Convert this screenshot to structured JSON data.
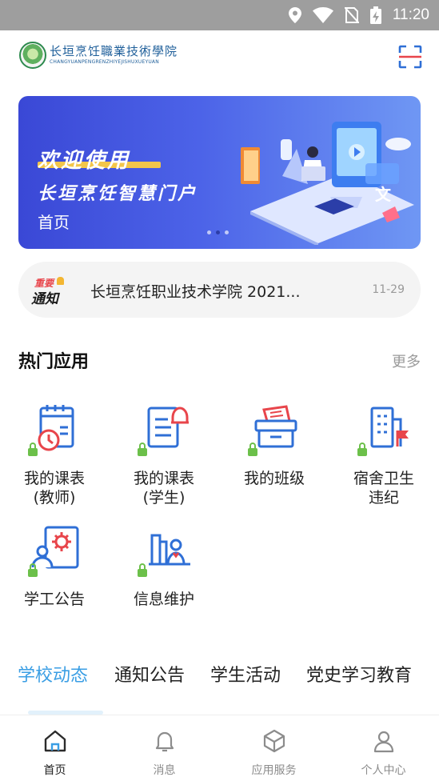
{
  "status_bar": {
    "time": "11:20"
  },
  "header": {
    "logo_cn": "长垣烹饪職業技術學院",
    "logo_en": "CHANGYUANPENGRENZHIYEJISHUXUEYUAN"
  },
  "banner": {
    "title": "欢迎使用",
    "subtitle": "长垣烹饪智慧门户",
    "caption": "首页",
    "active_dot": 1
  },
  "notice": {
    "badge_top": "重要",
    "badge_bottom": "通知",
    "text": "长垣烹饪职业技术学院 2021...",
    "date": "11-29"
  },
  "hot_apps": {
    "title": "热门应用",
    "more": "更多",
    "items": [
      {
        "line1": "我的课表",
        "line2": "(教师)",
        "icon": "calendar-clock-icon",
        "locked": true
      },
      {
        "line1": "我的课表",
        "line2": "(学生)",
        "icon": "document-bell-icon",
        "locked": true
      },
      {
        "line1": "我的班级",
        "line2": "",
        "icon": "class-box-icon",
        "locked": true
      },
      {
        "line1": "宿舍卫生",
        "line2": "违纪",
        "icon": "dorm-flag-icon",
        "locked": true
      },
      {
        "line1": "学工公告",
        "line2": "",
        "icon": "notice-gear-icon",
        "locked": true
      },
      {
        "line1": "信息维护",
        "line2": "",
        "icon": "info-maintain-icon",
        "locked": true
      }
    ]
  },
  "tabs": [
    "学校动态",
    "通知公告",
    "学生活动",
    "党史学习教育"
  ],
  "bottom_nav": [
    {
      "label": "首页",
      "icon": "home-icon",
      "active": true
    },
    {
      "label": "消息",
      "icon": "bell-icon",
      "active": false
    },
    {
      "label": "应用服务",
      "icon": "cube-icon",
      "active": false
    },
    {
      "label": "个人中心",
      "icon": "person-icon",
      "active": false
    }
  ],
  "colors": {
    "accent": "#3a9ee4",
    "icon_blue": "#2f6fd6",
    "icon_red": "#e8454b",
    "lock_green": "#6cc04a"
  }
}
